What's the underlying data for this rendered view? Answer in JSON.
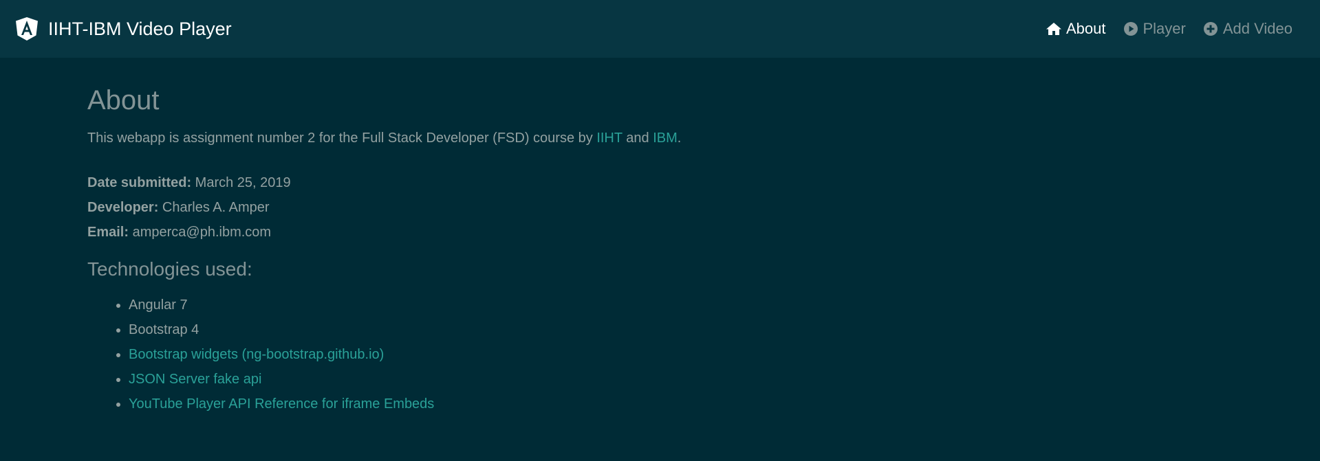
{
  "navbar": {
    "brand_title": "IIHT-IBM Video Player",
    "brand_icon": "angular-logo-icon",
    "links": [
      {
        "label": "About",
        "icon": "home-icon",
        "active": true
      },
      {
        "label": "Player",
        "icon": "play-circle-icon",
        "active": false
      },
      {
        "label": "Add Video",
        "icon": "plus-circle-icon",
        "active": false
      }
    ]
  },
  "about": {
    "title": "About",
    "intro_prefix": "This webapp is assignment number 2 for the Full Stack Developer (FSD) course by ",
    "link_iiht": "IIHT",
    "intro_and": " and ",
    "link_ibm": "IBM",
    "intro_suffix": ".",
    "date_label": "Date submitted:",
    "date_value": " March 25, 2019",
    "developer_label": "Developer:",
    "developer_value": " Charles A. Amper",
    "email_label": "Email:",
    "email_value": " amperca@ph.ibm.com",
    "tech_heading": "Technologies used:",
    "technologies": [
      {
        "label": "Angular 7",
        "is_link": false
      },
      {
        "label": "Bootstrap 4",
        "is_link": false
      },
      {
        "label": "Bootstrap widgets (ng-bootstrap.github.io)",
        "is_link": true
      },
      {
        "label": "JSON Server fake api",
        "is_link": true
      },
      {
        "label": "YouTube Player API Reference for iframe Embeds",
        "is_link": true
      }
    ]
  },
  "colors": {
    "background": "#002b36",
    "navbar": "#073642",
    "text": "#93a1a1",
    "link": "#2aa198",
    "active": "#ffffff"
  }
}
